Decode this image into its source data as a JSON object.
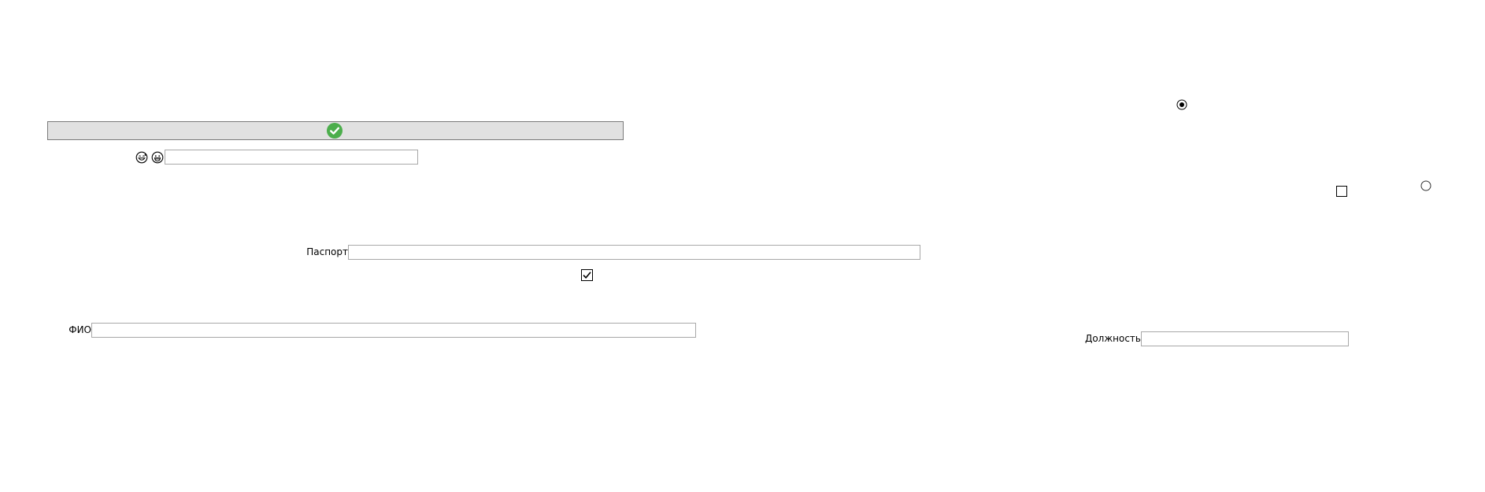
{
  "toolbar": {
    "status_icon": "check-circle-icon",
    "status_color": "#4cae4c"
  },
  "emoji_row": {
    "icons": [
      "grinning-sweat-face-icon",
      "grinning-face-icon"
    ],
    "input_value": "",
    "input_placeholder": ""
  },
  "passport": {
    "label": "Паспорт",
    "value": "",
    "placeholder": ""
  },
  "fio": {
    "label": "ФИО",
    "value": "",
    "placeholder": ""
  },
  "position": {
    "label": "Должность",
    "value": "",
    "placeholder": ""
  },
  "controls": {
    "radio_1_checked": true,
    "radio_2_checked": false,
    "checkbox_1_checked": true,
    "checkbox_2_checked": false
  }
}
